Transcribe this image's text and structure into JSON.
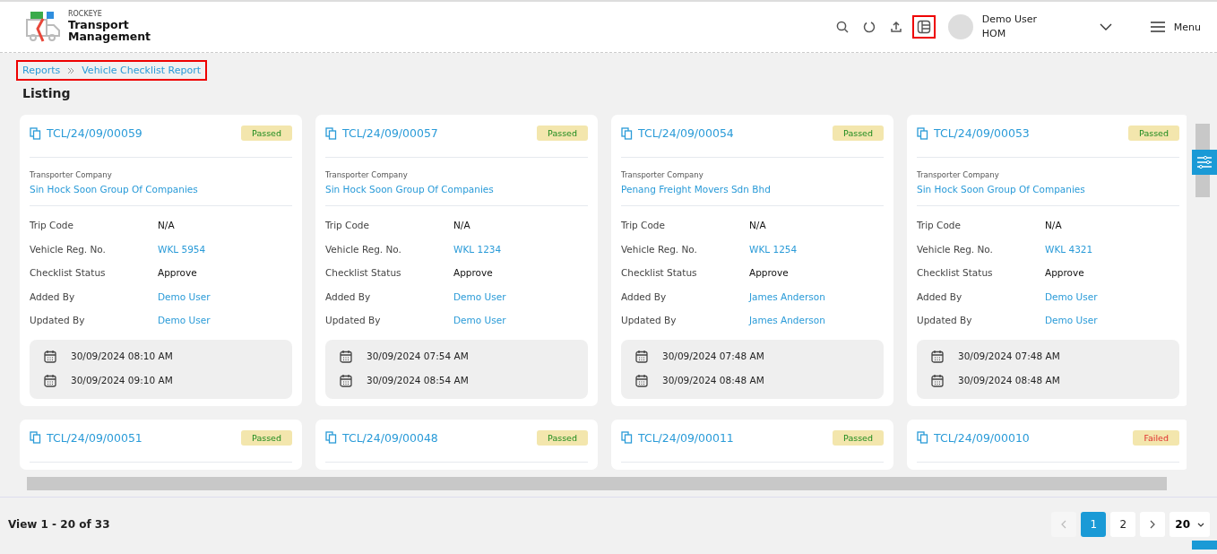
{
  "brand": {
    "company": "ROCKEYE",
    "line1": "Transport",
    "line2": "Management"
  },
  "user": {
    "name": "Demo User",
    "role": "HOM"
  },
  "menu_label": "Menu",
  "breadcrumb": [
    "Reports",
    "Vehicle Checklist Report"
  ],
  "heading": "Listing",
  "cards": [
    {
      "code": "TCL/24/09/00059",
      "status": "Passed",
      "kind": "passed",
      "company_label": "Transporter Company",
      "company": "Sin Hock Soon Group Of Companies",
      "fields": [
        {
          "label": "Trip Code",
          "value": "N/A",
          "link": false
        },
        {
          "label": "Vehicle Reg. No.",
          "value": "WKL 5954",
          "link": true
        },
        {
          "label": "Checklist Status",
          "value": "Approve",
          "link": false
        },
        {
          "label": "Added By",
          "value": "Demo User",
          "link": true
        },
        {
          "label": "Updated By",
          "value": "Demo User",
          "link": true
        }
      ],
      "dates": [
        "30/09/2024 08:10 AM",
        "30/09/2024 09:10 AM"
      ]
    },
    {
      "code": "TCL/24/09/00057",
      "status": "Passed",
      "kind": "passed",
      "company_label": "Transporter Company",
      "company": "Sin Hock Soon Group Of Companies",
      "fields": [
        {
          "label": "Trip Code",
          "value": "N/A",
          "link": false
        },
        {
          "label": "Vehicle Reg. No.",
          "value": "WKL 1234",
          "link": true
        },
        {
          "label": "Checklist Status",
          "value": "Approve",
          "link": false
        },
        {
          "label": "Added By",
          "value": "Demo User",
          "link": true
        },
        {
          "label": "Updated By",
          "value": "Demo User",
          "link": true
        }
      ],
      "dates": [
        "30/09/2024 07:54 AM",
        "30/09/2024 08:54 AM"
      ]
    },
    {
      "code": "TCL/24/09/00054",
      "status": "Passed",
      "kind": "passed",
      "company_label": "Transporter Company",
      "company": "Penang Freight Movers Sdn Bhd",
      "fields": [
        {
          "label": "Trip Code",
          "value": "N/A",
          "link": false
        },
        {
          "label": "Vehicle Reg. No.",
          "value": "WKL 1254",
          "link": true
        },
        {
          "label": "Checklist Status",
          "value": "Approve",
          "link": false
        },
        {
          "label": "Added By",
          "value": "James Anderson",
          "link": true
        },
        {
          "label": "Updated By",
          "value": "James Anderson",
          "link": true
        }
      ],
      "dates": [
        "30/09/2024 07:48 AM",
        "30/09/2024 08:48 AM"
      ]
    },
    {
      "code": "TCL/24/09/00053",
      "status": "Passed",
      "kind": "passed",
      "company_label": "Transporter Company",
      "company": "Sin Hock Soon Group Of Companies",
      "fields": [
        {
          "label": "Trip Code",
          "value": "N/A",
          "link": false
        },
        {
          "label": "Vehicle Reg. No.",
          "value": "WKL 4321",
          "link": true
        },
        {
          "label": "Checklist Status",
          "value": "Approve",
          "link": false
        },
        {
          "label": "Added By",
          "value": "Demo User",
          "link": true
        },
        {
          "label": "Updated By",
          "value": "Demo User",
          "link": true
        }
      ],
      "dates": [
        "30/09/2024 07:48 AM",
        "30/09/2024 08:48 AM"
      ]
    },
    {
      "code": "TCL/24/09/00051",
      "status": "Passed",
      "kind": "passed"
    },
    {
      "code": "TCL/24/09/00048",
      "status": "Passed",
      "kind": "passed"
    },
    {
      "code": "TCL/24/09/00011",
      "status": "Passed",
      "kind": "passed"
    },
    {
      "code": "TCL/24/09/00010",
      "status": "Failed",
      "kind": "failed"
    }
  ],
  "footer": {
    "summary": "View 1 - 20 of 33",
    "pages": [
      {
        "label": "1",
        "selected": true
      },
      {
        "label": "2",
        "selected": false
      }
    ],
    "page_size": "20"
  }
}
